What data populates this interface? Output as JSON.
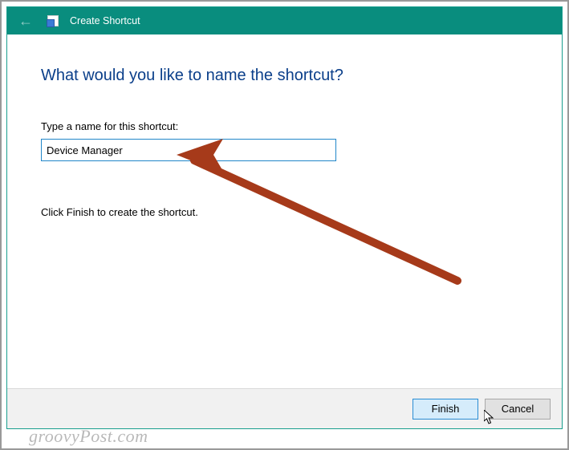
{
  "titlebar": {
    "title": "Create Shortcut"
  },
  "content": {
    "heading": "What would you like to name the shortcut?",
    "field_label": "Type a name for this shortcut:",
    "input_value": "Device Manager",
    "help_text": "Click Finish to create the shortcut."
  },
  "footer": {
    "finish_label": "Finish",
    "cancel_label": "Cancel"
  },
  "watermark": "groovyPost.com",
  "colors": {
    "titlebar_bg": "#098d7e",
    "heading_color": "#0b3f8a",
    "input_border": "#2186c9",
    "primary_btn_border": "#2a8dd4",
    "primary_btn_bg": "#d5ecfb",
    "arrow_color": "#a63a1a"
  }
}
